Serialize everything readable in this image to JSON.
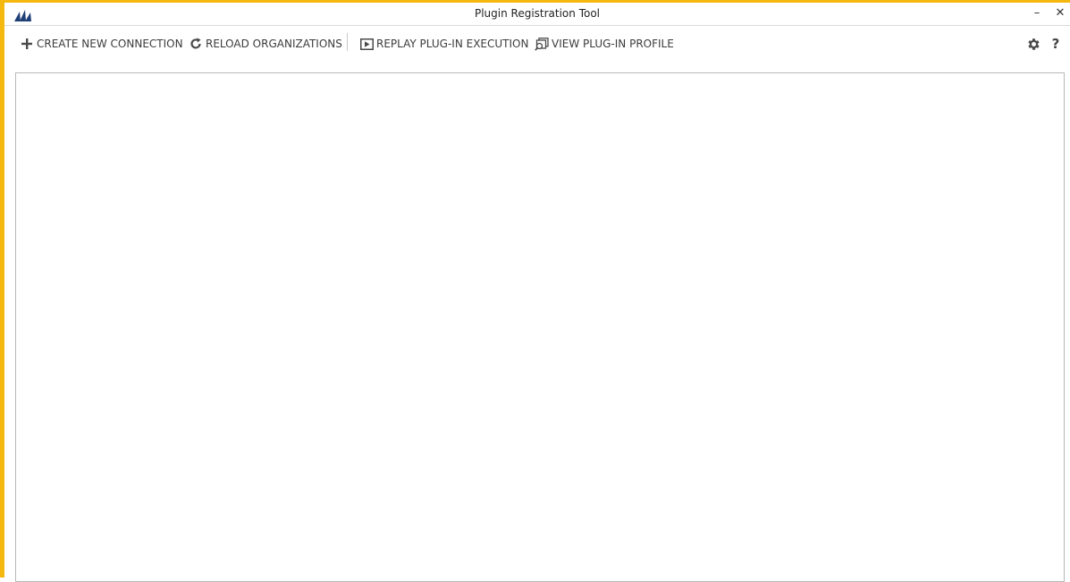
{
  "window": {
    "title": "Plugin Registration Tool",
    "frame_color": "#f5b80f",
    "minimize_glyph": "–",
    "close_glyph": "✕"
  },
  "toolbar": {
    "create_connection_label": "CREATE NEW CONNECTION",
    "reload_organizations_label": "RELOAD ORGANIZATIONS",
    "replay_execution_label": "REPLAY PLUG-IN EXECUTION",
    "view_profile_label": "VIEW PLUG-IN PROFILE",
    "help_glyph": "?"
  },
  "icons": {
    "app": "dynamics-logo-icon",
    "create": "plus-icon",
    "reload": "refresh-icon",
    "replay": "play-icon",
    "profile": "profile-view-icon",
    "settings": "gear-icon",
    "help": "help-icon"
  },
  "colors": {
    "logo_blue": "#1f3f77",
    "text": "#3c3c3c"
  }
}
